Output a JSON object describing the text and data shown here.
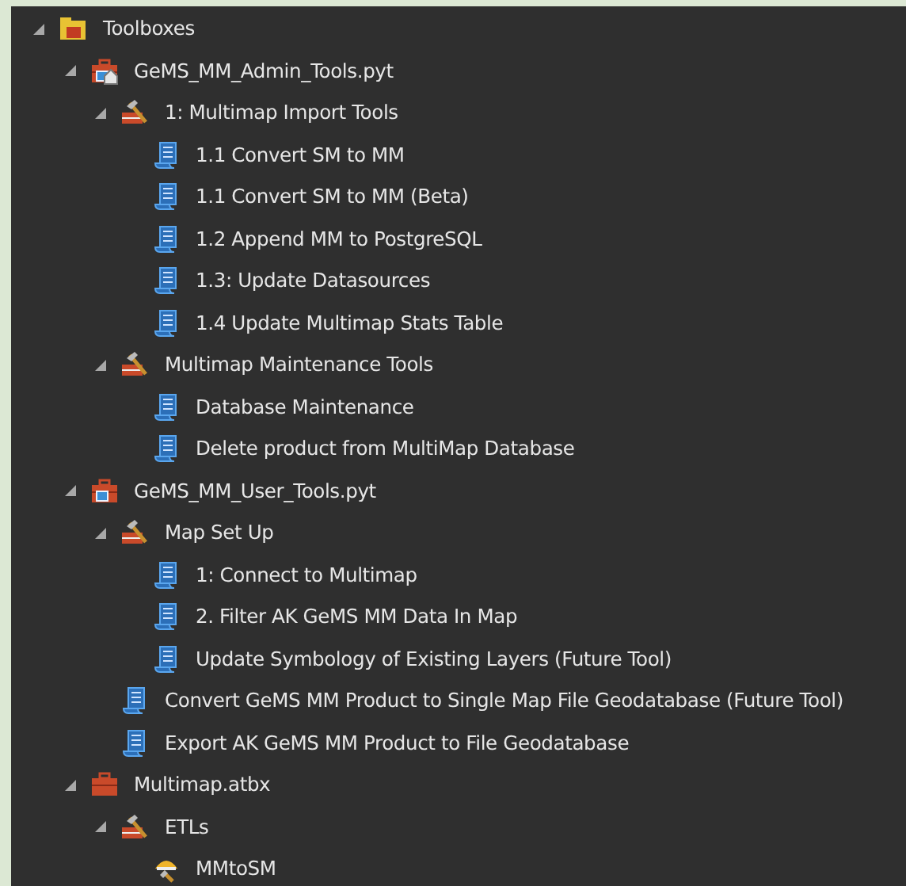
{
  "tree": [
    {
      "label": "Toolboxes",
      "kind": "folder",
      "expanded": true,
      "children": [
        {
          "label": "GeMS_MM_Admin_Tools.pyt",
          "kind": "python_toolbox",
          "expanded": true,
          "children": [
            {
              "label": "1: Multimap Import Tools",
              "kind": "toolset",
              "expanded": true,
              "children": [
                {
                  "label": "1.1 Convert SM to MM",
                  "kind": "script"
                },
                {
                  "label": "1.1 Convert SM to MM (Beta)",
                  "kind": "script"
                },
                {
                  "label": "1.2 Append MM to PostgreSQL",
                  "kind": "script"
                },
                {
                  "label": "1.3: Update Datasources",
                  "kind": "script"
                },
                {
                  "label": "1.4 Update Multimap Stats Table",
                  "kind": "script"
                }
              ]
            },
            {
              "label": "Multimap Maintenance Tools",
              "kind": "toolset",
              "expanded": true,
              "children": [
                {
                  "label": "Database Maintenance",
                  "kind": "script"
                },
                {
                  "label": "Delete product from MultiMap Database",
                  "kind": "script"
                }
              ]
            }
          ]
        },
        {
          "label": "GeMS_MM_User_Tools.pyt",
          "kind": "python_toolbox_user",
          "expanded": true,
          "children": [
            {
              "label": "Map Set Up",
              "kind": "toolset",
              "expanded": true,
              "children": [
                {
                  "label": "1: Connect to Multimap",
                  "kind": "script"
                },
                {
                  "label": "2. Filter AK GeMS MM Data In Map",
                  "kind": "script"
                },
                {
                  "label": "Update Symbology of Existing Layers (Future Tool)",
                  "kind": "script"
                }
              ]
            },
            {
              "label": "Convert GeMS MM Product to Single Map File Geodatabase (Future Tool)",
              "kind": "script"
            },
            {
              "label": "Export AK GeMS MM Product to File Geodatabase",
              "kind": "script"
            }
          ]
        },
        {
          "label": "Multimap.atbx",
          "kind": "toolbox",
          "expanded": true,
          "children": [
            {
              "label": "ETLs",
              "kind": "toolset",
              "expanded": true,
              "children": [
                {
                  "label": "MMtoSM",
                  "kind": "model"
                }
              ]
            }
          ]
        }
      ]
    }
  ]
}
